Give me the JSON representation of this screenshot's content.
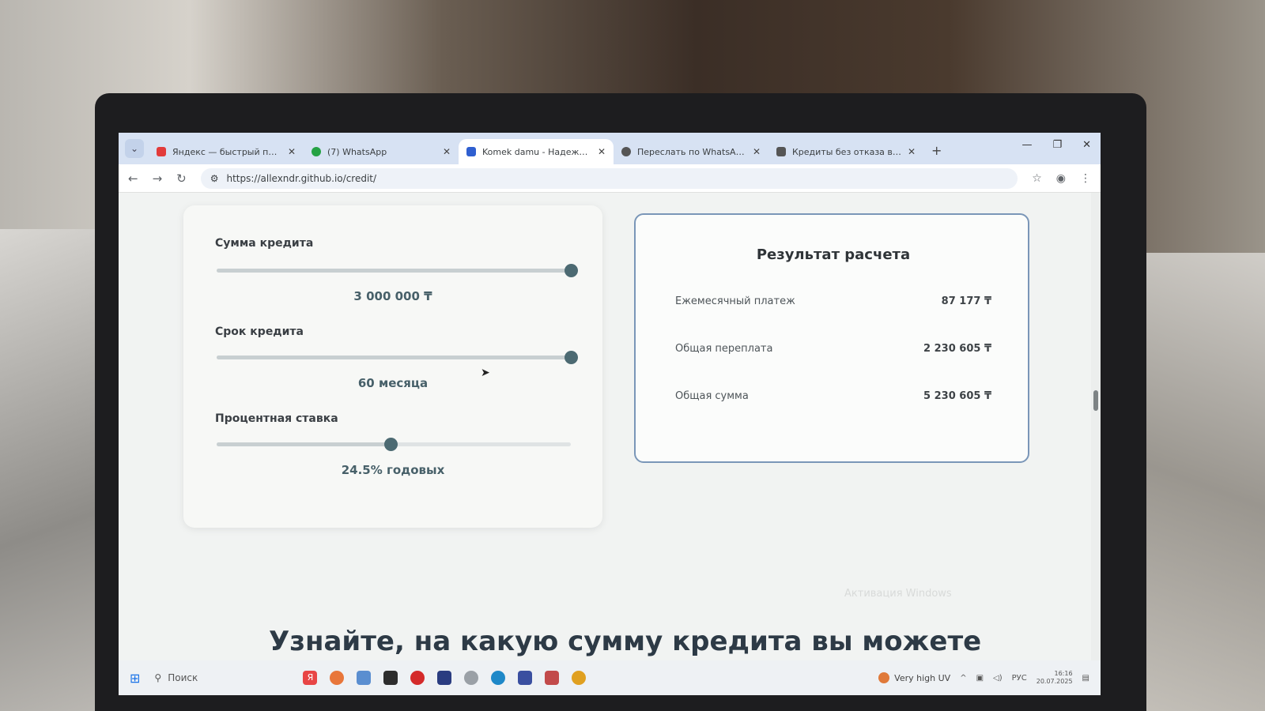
{
  "browser": {
    "tabs": [
      {
        "title": "Яндекс — быстрый поиск в и",
        "icon": "yandex-icon",
        "color": "#e23b3b",
        "active": false
      },
      {
        "title": "(7) WhatsApp",
        "icon": "whatsapp-icon",
        "color": "#25a244",
        "active": false
      },
      {
        "title": "Komek damu - Надежное кред",
        "icon": "page-icon",
        "color": "#2f5fd0",
        "active": true
      },
      {
        "title": "Переслать по WhatsApp",
        "icon": "globe-icon",
        "color": "#555555",
        "active": false
      },
      {
        "title": "Кредиты без отказа в Казахст",
        "icon": "page-icon",
        "color": "#555555",
        "active": false
      }
    ],
    "new_tab": "+",
    "url": "https://allexndr.github.io/credit/"
  },
  "calculator": {
    "amount": {
      "label": "Сумма кредита",
      "value": "3 000 000 ₸",
      "level": 1.0
    },
    "term": {
      "label": "Срок кредита",
      "value": "60 месяца",
      "level": 1.0
    },
    "rate": {
      "label": "Процентная ставка",
      "value": "24.5% годовых",
      "level": 0.49
    }
  },
  "result": {
    "title": "Результат расчета",
    "rows": [
      {
        "label": "Ежемесячный платеж",
        "value": "87 177 ₸"
      },
      {
        "label": "Общая переплата",
        "value": "2 230 605 ₸"
      },
      {
        "label": "Общая сумма",
        "value": "5 230 605 ₸"
      }
    ]
  },
  "watermark": "Активация Windows",
  "headline": "Узнайте, на какую сумму кредита вы можете",
  "taskbar": {
    "search": "Поиск",
    "weather": "Very high UV",
    "lang": "РУС",
    "time": "16:16",
    "date": "20.07.2025"
  }
}
